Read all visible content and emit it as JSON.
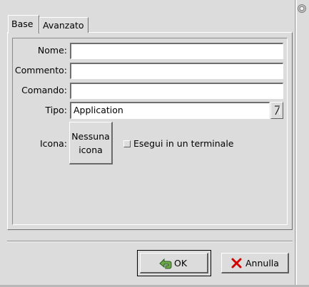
{
  "tabs": [
    {
      "label": "Base",
      "active": true
    },
    {
      "label": "Avanzato",
      "active": false
    }
  ],
  "form": {
    "name_label": "Nome:",
    "name_value": "",
    "comment_label": "Commento:",
    "comment_value": "",
    "command_label": "Comando:",
    "command_value": "",
    "type_label": "Tipo:",
    "type_value": "Application",
    "icon_label": "Icona:",
    "icon_button_line1": "Nessuna",
    "icon_button_line2": "icona",
    "terminal_label": "Esegui in un terminale",
    "terminal_checked": false
  },
  "buttons": {
    "ok_label": "OK",
    "cancel_label": "Annulla"
  },
  "icons": {
    "ok": "ok-arrow-icon",
    "cancel": "cancel-x-icon",
    "combo": "dropdown-arrow-icon",
    "close": "window-close-icon"
  },
  "colors": {
    "background": "#dcdcdc",
    "cancel_icon": "#d40000",
    "ok_icon": "#5a9a3a"
  }
}
